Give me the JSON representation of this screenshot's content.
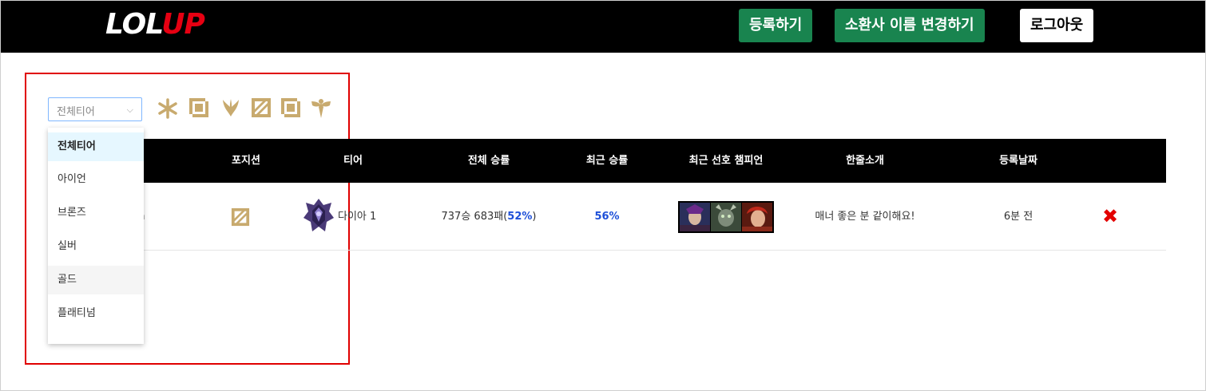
{
  "header": {
    "logo_main": "LOL",
    "logo_accent": "UP",
    "register_label": "등록하기",
    "rename_label": "소환사 이름 변경하기",
    "logout_label": "로그아웃"
  },
  "filter": {
    "selected": "전체티어",
    "options": [
      "전체티어",
      "아이언",
      "브론즈",
      "실버",
      "골드",
      "플래티넘"
    ],
    "position_icons": [
      "top-lane-icon",
      "jungle-icon",
      "mid-lane-icon",
      "bottom-lane-icon",
      "support-icon"
    ]
  },
  "table": {
    "headers": {
      "position": "포지션",
      "tier": "티어",
      "overall_winrate": "전체 승률",
      "recent_winrate": "최근 승률",
      "recent_champions": "최근 선호 챔피언",
      "intro": "한줄소개",
      "date": "등록날짜"
    },
    "rows": [
      {
        "name": "bush",
        "position_icon": "bottom-lane-icon",
        "tier_icon": "diamond-emblem-icon",
        "tier": "다이아 1",
        "record": "737승 683패(",
        "winrate": "52%",
        "record_close": ")",
        "recent_winrate": "56%",
        "champions": [
          "champion-1",
          "champion-2",
          "champion-3"
        ],
        "intro": "매너 좋은 분 같이해요!",
        "date": "6분 전",
        "delete_icon": "close-icon"
      }
    ]
  },
  "colors": {
    "header_bg": "#000000",
    "brand_accent": "#e60012",
    "button_green": "#19844f",
    "icon_gold": "#c8aa6e",
    "winrate_blue": "#1d4fd8",
    "highlight": "#e00000"
  }
}
